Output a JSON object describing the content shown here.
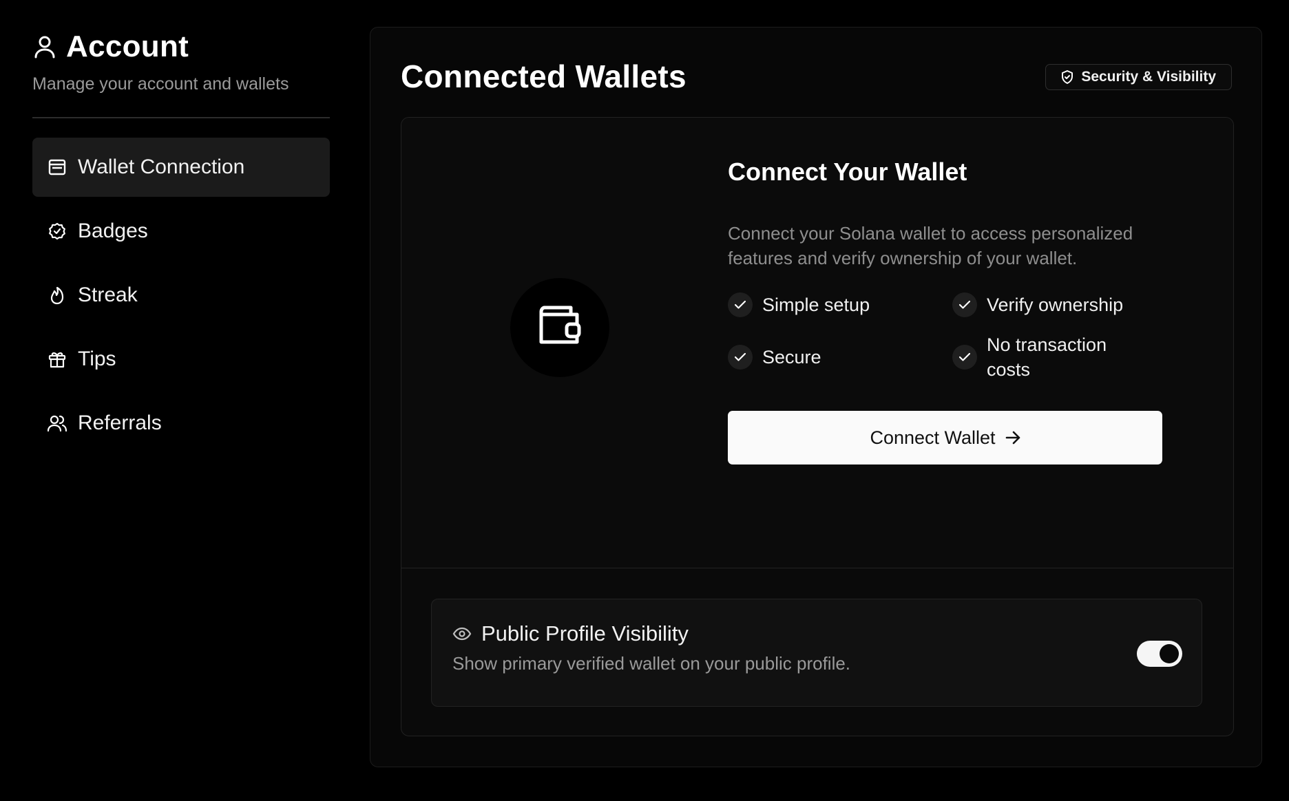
{
  "sidebar": {
    "title": "Account",
    "subtitle": "Manage your account and wallets",
    "title_icon": "user-icon",
    "items": [
      {
        "label": "Wallet Connection",
        "icon": "card-icon",
        "active": true
      },
      {
        "label": "Badges",
        "icon": "badge-check-icon",
        "active": false
      },
      {
        "label": "Streak",
        "icon": "flame-icon",
        "active": false
      },
      {
        "label": "Tips",
        "icon": "gift-icon",
        "active": false
      },
      {
        "label": "Referrals",
        "icon": "users-icon",
        "active": false
      }
    ]
  },
  "main": {
    "title": "Connected Wallets",
    "badge_label": "Security & Visibility",
    "badge_icon": "shield-check-icon",
    "connect": {
      "title": "Connect Your Wallet",
      "description": "Connect your Solana wallet to access personalized features and verify ownership of your wallet.",
      "wallet_icon": "wallet-icon",
      "features": [
        "Simple setup",
        "Verify ownership",
        "Secure",
        "No transaction costs"
      ],
      "button_label": "Connect Wallet",
      "button_icon": "arrow-right-icon"
    },
    "visibility": {
      "title": "Public Profile Visibility",
      "description": "Show primary verified wallet on your public profile.",
      "icon": "eye-icon",
      "enabled": true
    }
  },
  "colors": {
    "background": "#000000",
    "panel": "#070707",
    "active_nav": "#1b1b1b",
    "muted_text": "#9a9a9a",
    "button_bg": "#fafafa"
  }
}
